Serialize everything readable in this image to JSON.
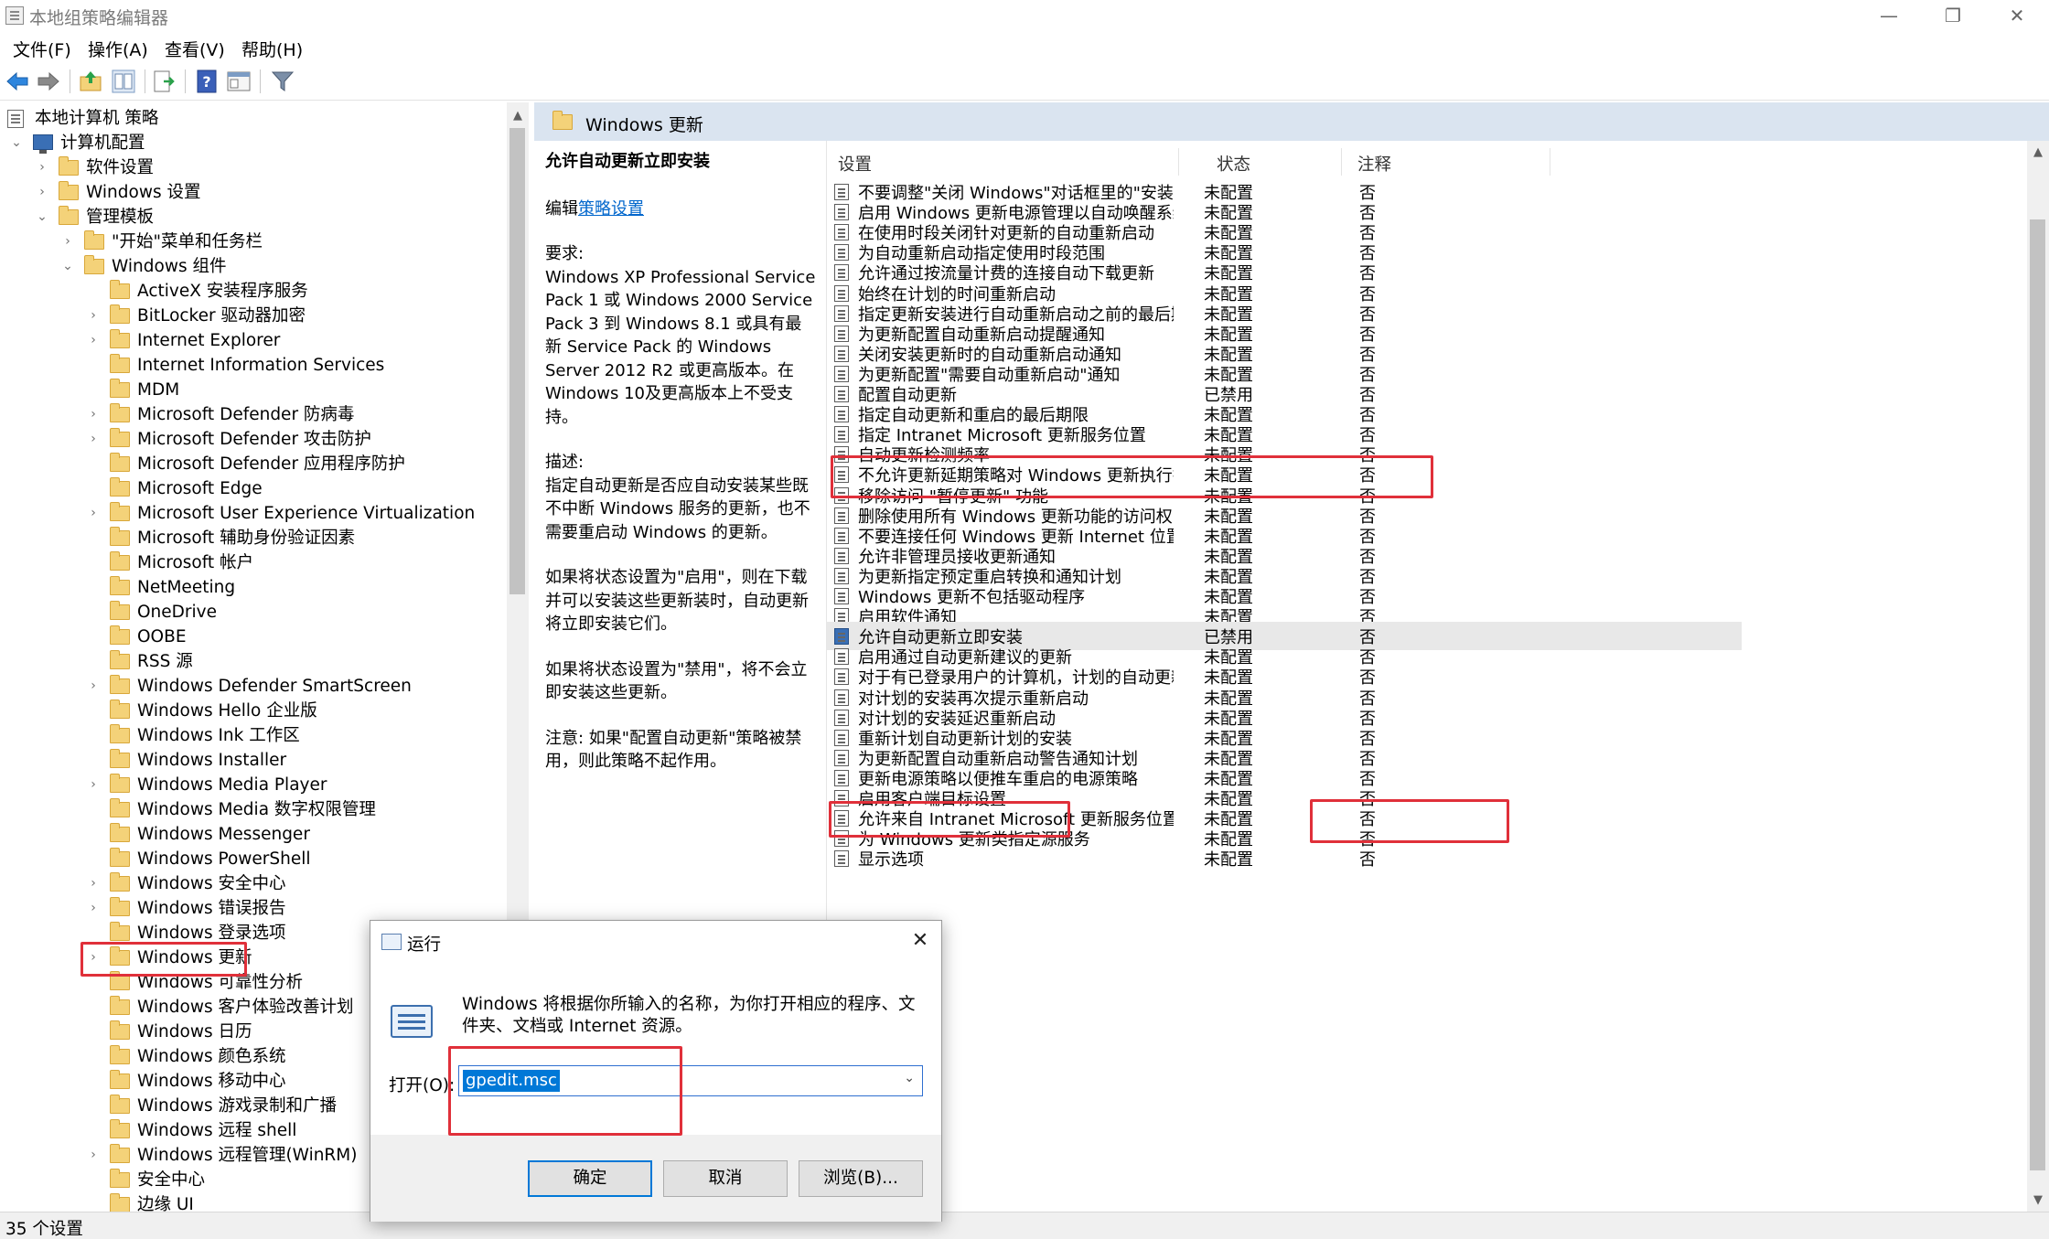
{
  "window": {
    "title": "本地组策略编辑器",
    "min_glyph": "—",
    "restore_glyph": "❐",
    "close_glyph": "✕"
  },
  "menu": [
    "文件(F)",
    "操作(A)",
    "查看(V)",
    "帮助(H)"
  ],
  "toolbar": [
    "back-icon",
    "forward-icon",
    "up-folder-icon",
    "show-hide-tree-icon",
    "export-list-icon",
    "help-icon",
    "properties-icon",
    "filter-icon"
  ],
  "tree": {
    "root": "本地计算机 策略",
    "computer_config": "计算机配置",
    "software_settings": "软件设置",
    "windows_settings": "Windows 设置",
    "admin_templates": "管理模板",
    "start_menu": "\"开始\"菜单和任务栏",
    "windows_components": "Windows 组件",
    "components": [
      {
        "label": "ActiveX 安装程序服务",
        "exp": false
      },
      {
        "label": "BitLocker 驱动器加密",
        "exp": true
      },
      {
        "label": "Internet Explorer",
        "exp": true
      },
      {
        "label": "Internet Information Services",
        "exp": false
      },
      {
        "label": "MDM",
        "exp": false
      },
      {
        "label": "Microsoft Defender 防病毒",
        "exp": true
      },
      {
        "label": "Microsoft Defender 攻击防护",
        "exp": true
      },
      {
        "label": "Microsoft Defender 应用程序防护",
        "exp": false
      },
      {
        "label": "Microsoft Edge",
        "exp": false
      },
      {
        "label": "Microsoft User Experience Virtualization",
        "exp": true
      },
      {
        "label": "Microsoft 辅助身份验证因素",
        "exp": false
      },
      {
        "label": "Microsoft 帐户",
        "exp": false
      },
      {
        "label": "NetMeeting",
        "exp": false
      },
      {
        "label": "OneDrive",
        "exp": false
      },
      {
        "label": "OOBE",
        "exp": false
      },
      {
        "label": "RSS 源",
        "exp": false
      },
      {
        "label": "Windows Defender SmartScreen",
        "exp": true
      },
      {
        "label": "Windows Hello 企业版",
        "exp": false
      },
      {
        "label": "Windows Ink 工作区",
        "exp": false
      },
      {
        "label": "Windows Installer",
        "exp": false
      },
      {
        "label": "Windows Media Player",
        "exp": true
      },
      {
        "label": "Windows Media 数字权限管理",
        "exp": false
      },
      {
        "label": "Windows Messenger",
        "exp": false
      },
      {
        "label": "Windows PowerShell",
        "exp": false
      },
      {
        "label": "Windows 安全中心",
        "exp": true
      },
      {
        "label": "Windows 错误报告",
        "exp": true
      },
      {
        "label": "Windows 登录选项",
        "exp": false
      },
      {
        "label": "Windows 更新",
        "exp": true
      },
      {
        "label": "Windows 可靠性分析",
        "exp": false
      },
      {
        "label": "Windows 客户体验改善计划",
        "exp": false
      },
      {
        "label": "Windows 日历",
        "exp": false
      },
      {
        "label": "Windows 颜色系统",
        "exp": false
      },
      {
        "label": "Windows 移动中心",
        "exp": false
      },
      {
        "label": "Windows 游戏录制和广播",
        "exp": false
      },
      {
        "label": "Windows 远程 shell",
        "exp": false
      },
      {
        "label": "Windows 远程管理(WinRM)",
        "exp": true
      },
      {
        "label": "安全中心",
        "exp": false
      },
      {
        "label": "边缘 UI",
        "exp": false
      }
    ]
  },
  "right_header": {
    "title": "Windows 更新"
  },
  "description": {
    "title": "允许自动更新立即安装",
    "edit_prefix": "编辑",
    "edit_link": "策略设置",
    "req_label": "要求:",
    "req_text": "Windows XP Professional Service Pack 1 或 Windows 2000 Service Pack 3 到 Windows 8.1 或具有最新 Service Pack 的 Windows Server 2012 R2 或更高版本。在Windows 10及更高版本上不受支持。",
    "desc_label": "描述:",
    "desc_text": "指定自动更新是否应自动安装某些既不中断 Windows 服务的更新，也不需要重启动 Windows 的更新。",
    "p_enabled": "如果将状态设置为\"启用\"，则在下载并可以安装这些更新装时，自动更新将立即安装它们。",
    "p_disabled": "如果将状态设置为\"禁用\"，将不会立即安装这些更新。",
    "p_note": "注意: 如果\"配置自动更新\"策略被禁用，则此策略不起作用。"
  },
  "columns": {
    "setting": "设置",
    "state": "状态",
    "note": "注释"
  },
  "rows": [
    {
      "name": "不要调整\"关闭 Windows\"对话框里的\"安装更新并关机\"的默...",
      "state": "未配置",
      "note": "否"
    },
    {
      "name": "启用 Windows 更新电源管理以自动唤醒系统来安装计划的...",
      "state": "未配置",
      "note": "否"
    },
    {
      "name": "在使用时段关闭针对更新的自动重新启动",
      "state": "未配置",
      "note": "否"
    },
    {
      "name": "为自动重新启动指定使用时段范围",
      "state": "未配置",
      "note": "否"
    },
    {
      "name": "允许通过按流量计费的连接自动下载更新",
      "state": "未配置",
      "note": "否"
    },
    {
      "name": "始终在计划的时间重新启动",
      "state": "未配置",
      "note": "否"
    },
    {
      "name": "指定更新安装进行自动重新启动之前的最后期限",
      "state": "未配置",
      "note": "否"
    },
    {
      "name": "为更新配置自动重新启动提醒通知",
      "state": "未配置",
      "note": "否"
    },
    {
      "name": "关闭安装更新时的自动重新启动通知",
      "state": "未配置",
      "note": "否"
    },
    {
      "name": "为更新配置\"需要自动重新启动\"通知",
      "state": "未配置",
      "note": "否"
    },
    {
      "name": "配置自动更新",
      "state": "已禁用",
      "note": "否"
    },
    {
      "name": "指定自动更新和重启的最后期限",
      "state": "未配置",
      "note": "否"
    },
    {
      "name": "指定 Intranet Microsoft 更新服务位置",
      "state": "未配置",
      "note": "否"
    },
    {
      "name": "自动更新检测频率",
      "state": "未配置",
      "note": "否"
    },
    {
      "name": "不允许更新延期策略对 Windows 更新执行扫描",
      "state": "未配置",
      "note": "否"
    },
    {
      "name": "移除访问 \"暂停更新\" 功能",
      "state": "未配置",
      "note": "否"
    },
    {
      "name": "删除使用所有 Windows 更新功能的访问权限",
      "state": "未配置",
      "note": "否"
    },
    {
      "name": "不要连接任何 Windows 更新 Internet 位置",
      "state": "未配置",
      "note": "否"
    },
    {
      "name": "允许非管理员接收更新通知",
      "state": "未配置",
      "note": "否"
    },
    {
      "name": "为更新指定预定重启转换和通知计划",
      "state": "未配置",
      "note": "否"
    },
    {
      "name": "Windows 更新不包括驱动程序",
      "state": "未配置",
      "note": "否"
    },
    {
      "name": "启用软件通知",
      "state": "未配置",
      "note": "否"
    },
    {
      "name": "允许自动更新立即安装",
      "state": "已禁用",
      "note": "否"
    },
    {
      "name": "启用通过自动更新建议的更新",
      "state": "未配置",
      "note": "否"
    },
    {
      "name": "对于有已登录用户的计算机，计划的自动更新安装不执行重...",
      "state": "未配置",
      "note": "否"
    },
    {
      "name": "对计划的安装再次提示重新启动",
      "state": "未配置",
      "note": "否"
    },
    {
      "name": "对计划的安装延迟重新启动",
      "state": "未配置",
      "note": "否"
    },
    {
      "name": "重新计划自动更新计划的安装",
      "state": "未配置",
      "note": "否"
    },
    {
      "name": "为更新配置自动重新启动警告通知计划",
      "state": "未配置",
      "note": "否"
    },
    {
      "name": "更新电源策略以便推车重启的电源策略",
      "state": "未配置",
      "note": "否"
    },
    {
      "name": "启用客户端目标设置",
      "state": "未配置",
      "note": "否"
    },
    {
      "name": "允许来自 Intranet Microsoft 更新服务位置的签名更新",
      "state": "未配置",
      "note": "否"
    },
    {
      "name": "为 Windows 更新类指定源服务",
      "state": "未配置",
      "note": "否"
    },
    {
      "name": "显示选项",
      "state": "未配置",
      "note": "否"
    }
  ],
  "status": "35 个设置",
  "run_dialog": {
    "title": "运行",
    "close_glyph": "✕",
    "message": "Windows 将根据你所输入的名称，为你打开相应的程序、文件夹、文档或 Internet 资源。",
    "open_label": "打开(O):",
    "input_value": "gpedit.msc",
    "ok": "确定",
    "cancel": "取消",
    "browse": "浏览(B)..."
  },
  "highlight_color": "#e0303a"
}
